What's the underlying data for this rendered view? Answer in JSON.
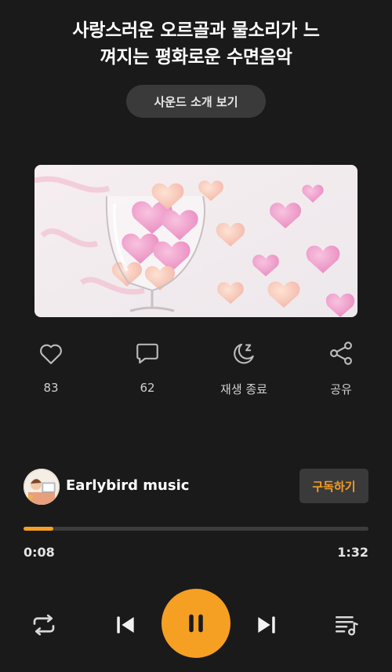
{
  "title_line1": "사랑스러운 오르골과 물소리가 느",
  "title_line2": "껴지는 평화로운 수면음악",
  "intro_button": "사운드 소개 보기",
  "actions": {
    "like": "83",
    "comments": "62",
    "sleep_timer": "재생 종료",
    "share": "공유"
  },
  "channel": {
    "name": "Earlybird music",
    "subscribe": "구독하기"
  },
  "player": {
    "current_time": "0:08",
    "duration": "1:32",
    "progress_percent": 8.7
  },
  "colors": {
    "accent": "#f5a023",
    "background": "#1a1a1a"
  }
}
